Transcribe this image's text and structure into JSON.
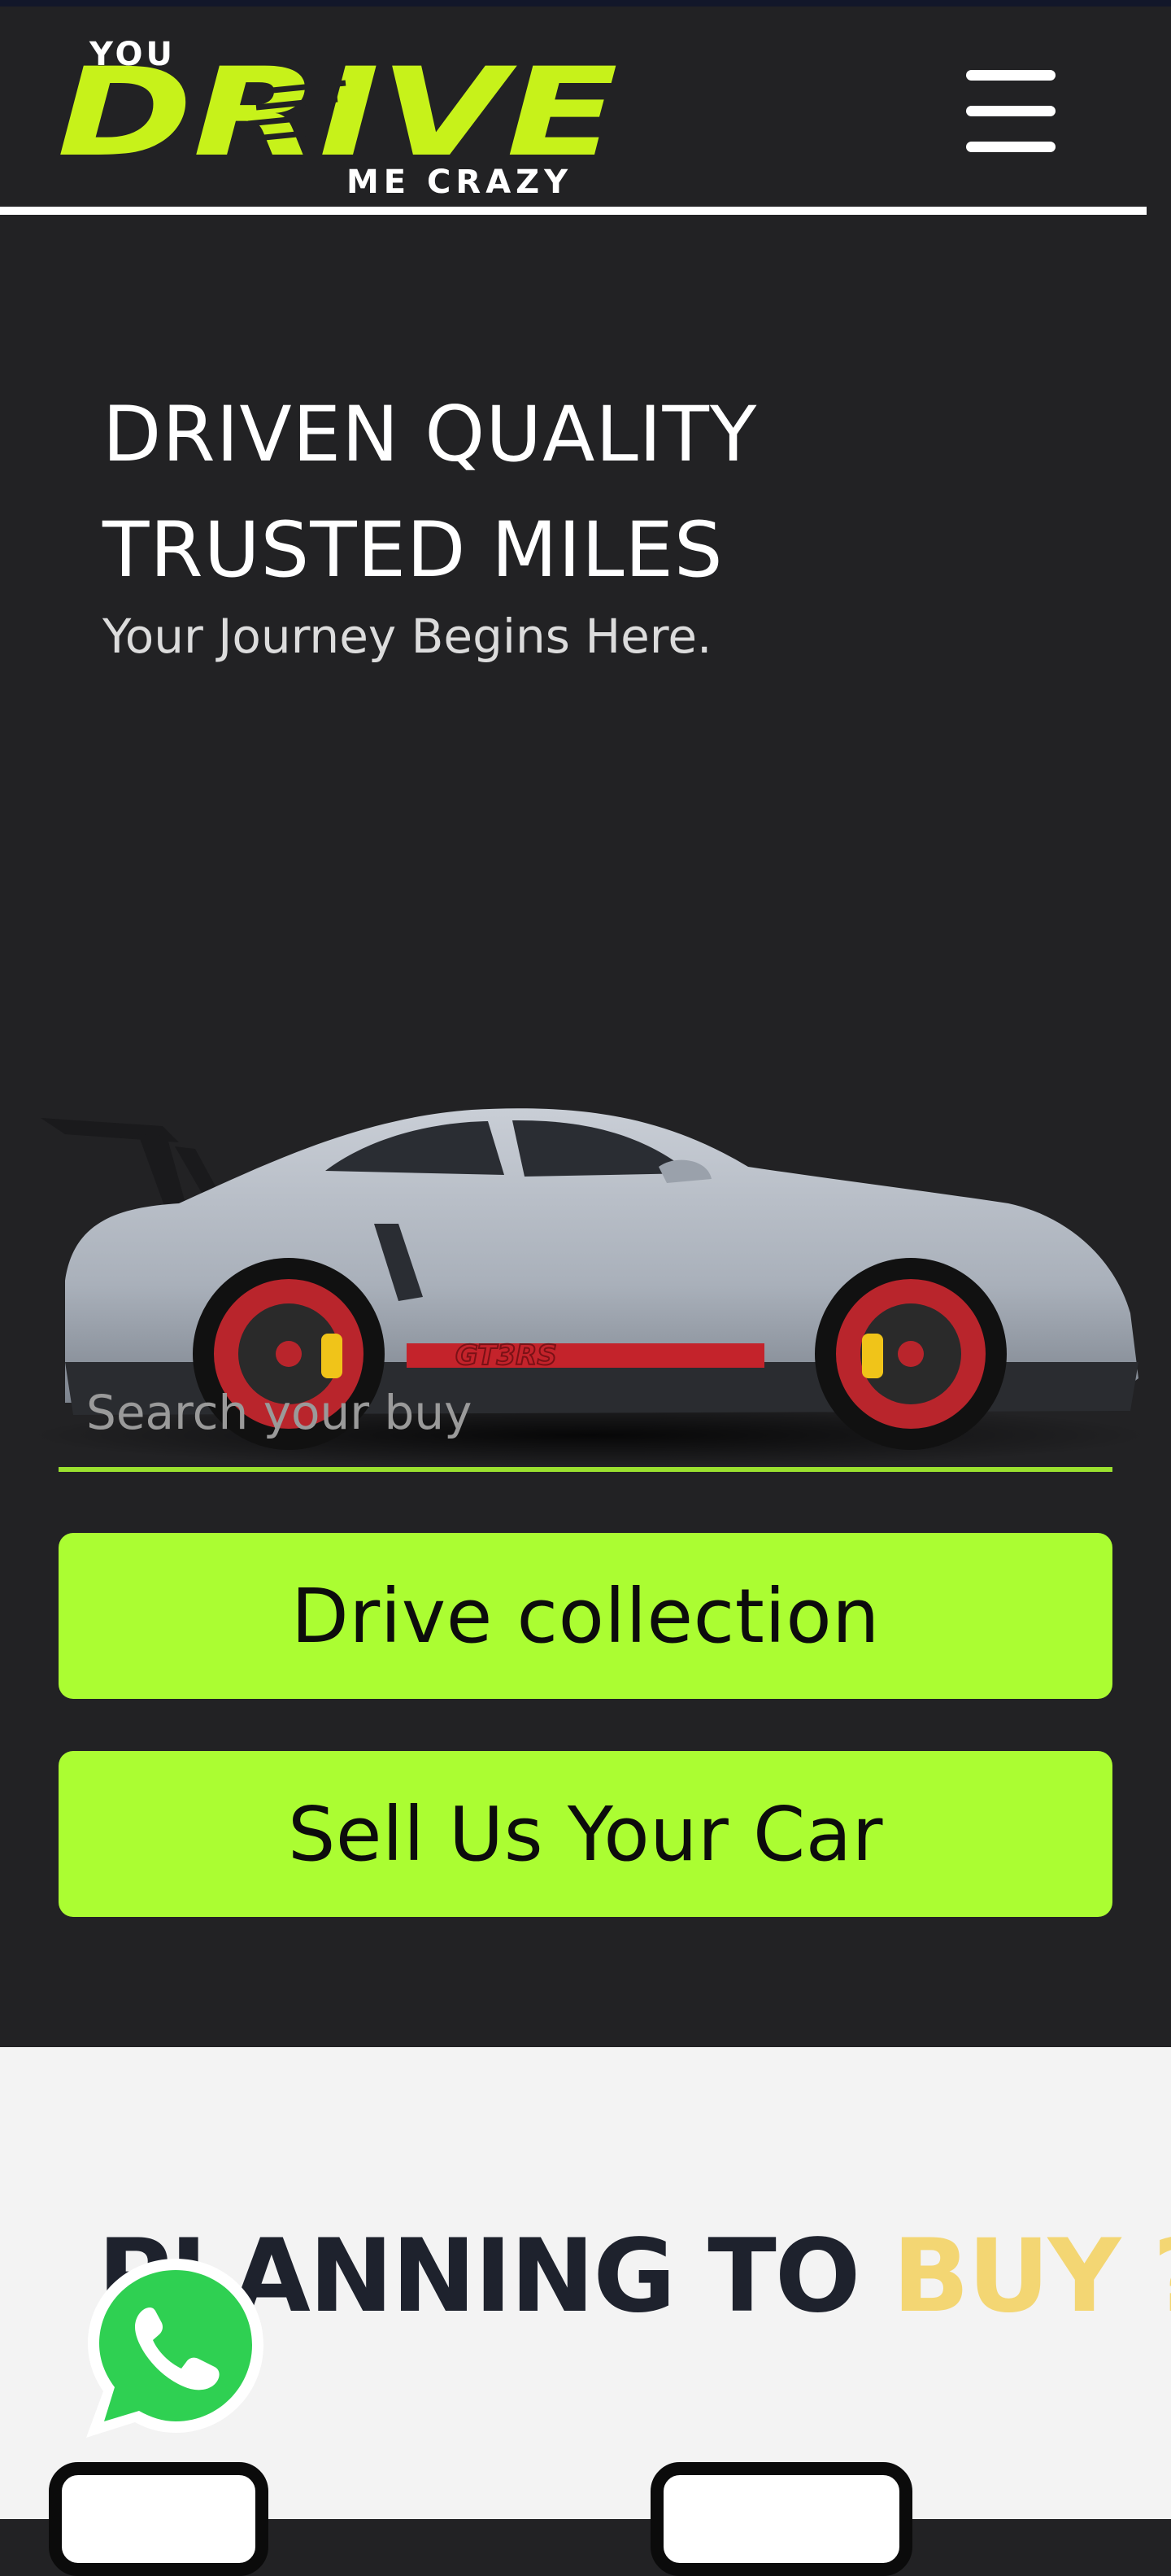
{
  "header": {
    "logo": {
      "top": "YOU",
      "main": "DRIVE",
      "bottom": "ME CRAZY",
      "accent": "#c7f21a"
    },
    "menu_icon": "hamburger-menu-icon"
  },
  "hero": {
    "headline_line1": "DRIVEN QUALITY",
    "headline_line2": "TRUSTED MILES",
    "tagline": "Your Journey Begins Here.",
    "car_image": "porsche-gt3rs-image",
    "car_badge": "GT3RS"
  },
  "search": {
    "placeholder": "Search your buy",
    "value": ""
  },
  "buttons": {
    "drive_collection": "Drive collection",
    "sell_car": "Sell Us Your Car"
  },
  "section": {
    "title_main": "PLANNING TO ",
    "title_accent": "BUY ?",
    "accent_color": "#f3d673"
  },
  "floating": {
    "whatsapp_icon": "whatsapp-icon"
  },
  "colors": {
    "background": "#222224",
    "button": "#abfd32",
    "search_underline": "#9be12f"
  }
}
